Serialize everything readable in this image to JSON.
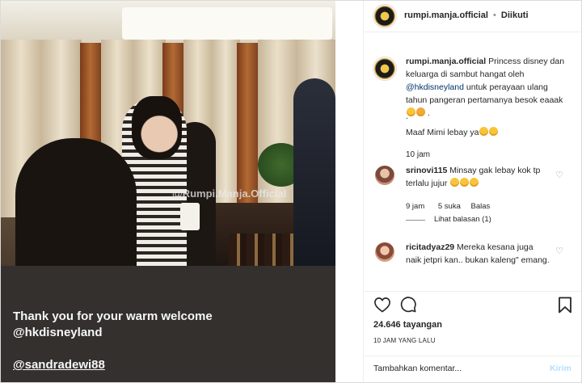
{
  "post": {
    "username": "rumpi.manja.official",
    "separator": "•",
    "follow_status": "Diikuti",
    "caption_parts": {
      "text1": "Princess disney dan keluarga di sambut hangat oleh ",
      "mention": "@hkdisneyland",
      "text2": " untuk perayaan ulang tahun pangeran pertamanya besok eaaak",
      "text3": " .",
      "dot": ".",
      "text4": "Maaf Mimi lebay ya"
    },
    "caption_time": "10 jam",
    "likes": "24.646 tayangan",
    "timestamp": "10 JAM YANG LALU"
  },
  "media": {
    "watermark": "@Rumpi.Manja.Official",
    "caption_line1": "Thank you for your warm welcome",
    "caption_line2": "@hkdisneyland",
    "caption_line3": "@sandradewi88"
  },
  "comments": [
    {
      "username": "srinovi115",
      "text": " Minsay gak lebay kok tp terlalu jujur",
      "time": "9 jam",
      "likes": "5 suka",
      "reply": "Balas",
      "view_replies": "Lihat balasan (1)"
    },
    {
      "username": "ricitadyaz29",
      "text": " Mereka kesana juga naik jetpri kan.. bukan kaleng\" emang."
    }
  ],
  "composer": {
    "placeholder": "Tambahkan komentar...",
    "send": "Kirim"
  },
  "colors": {
    "link": "#003569",
    "muted": "#8e8e8e",
    "send_disabled": "#b2dffc"
  }
}
